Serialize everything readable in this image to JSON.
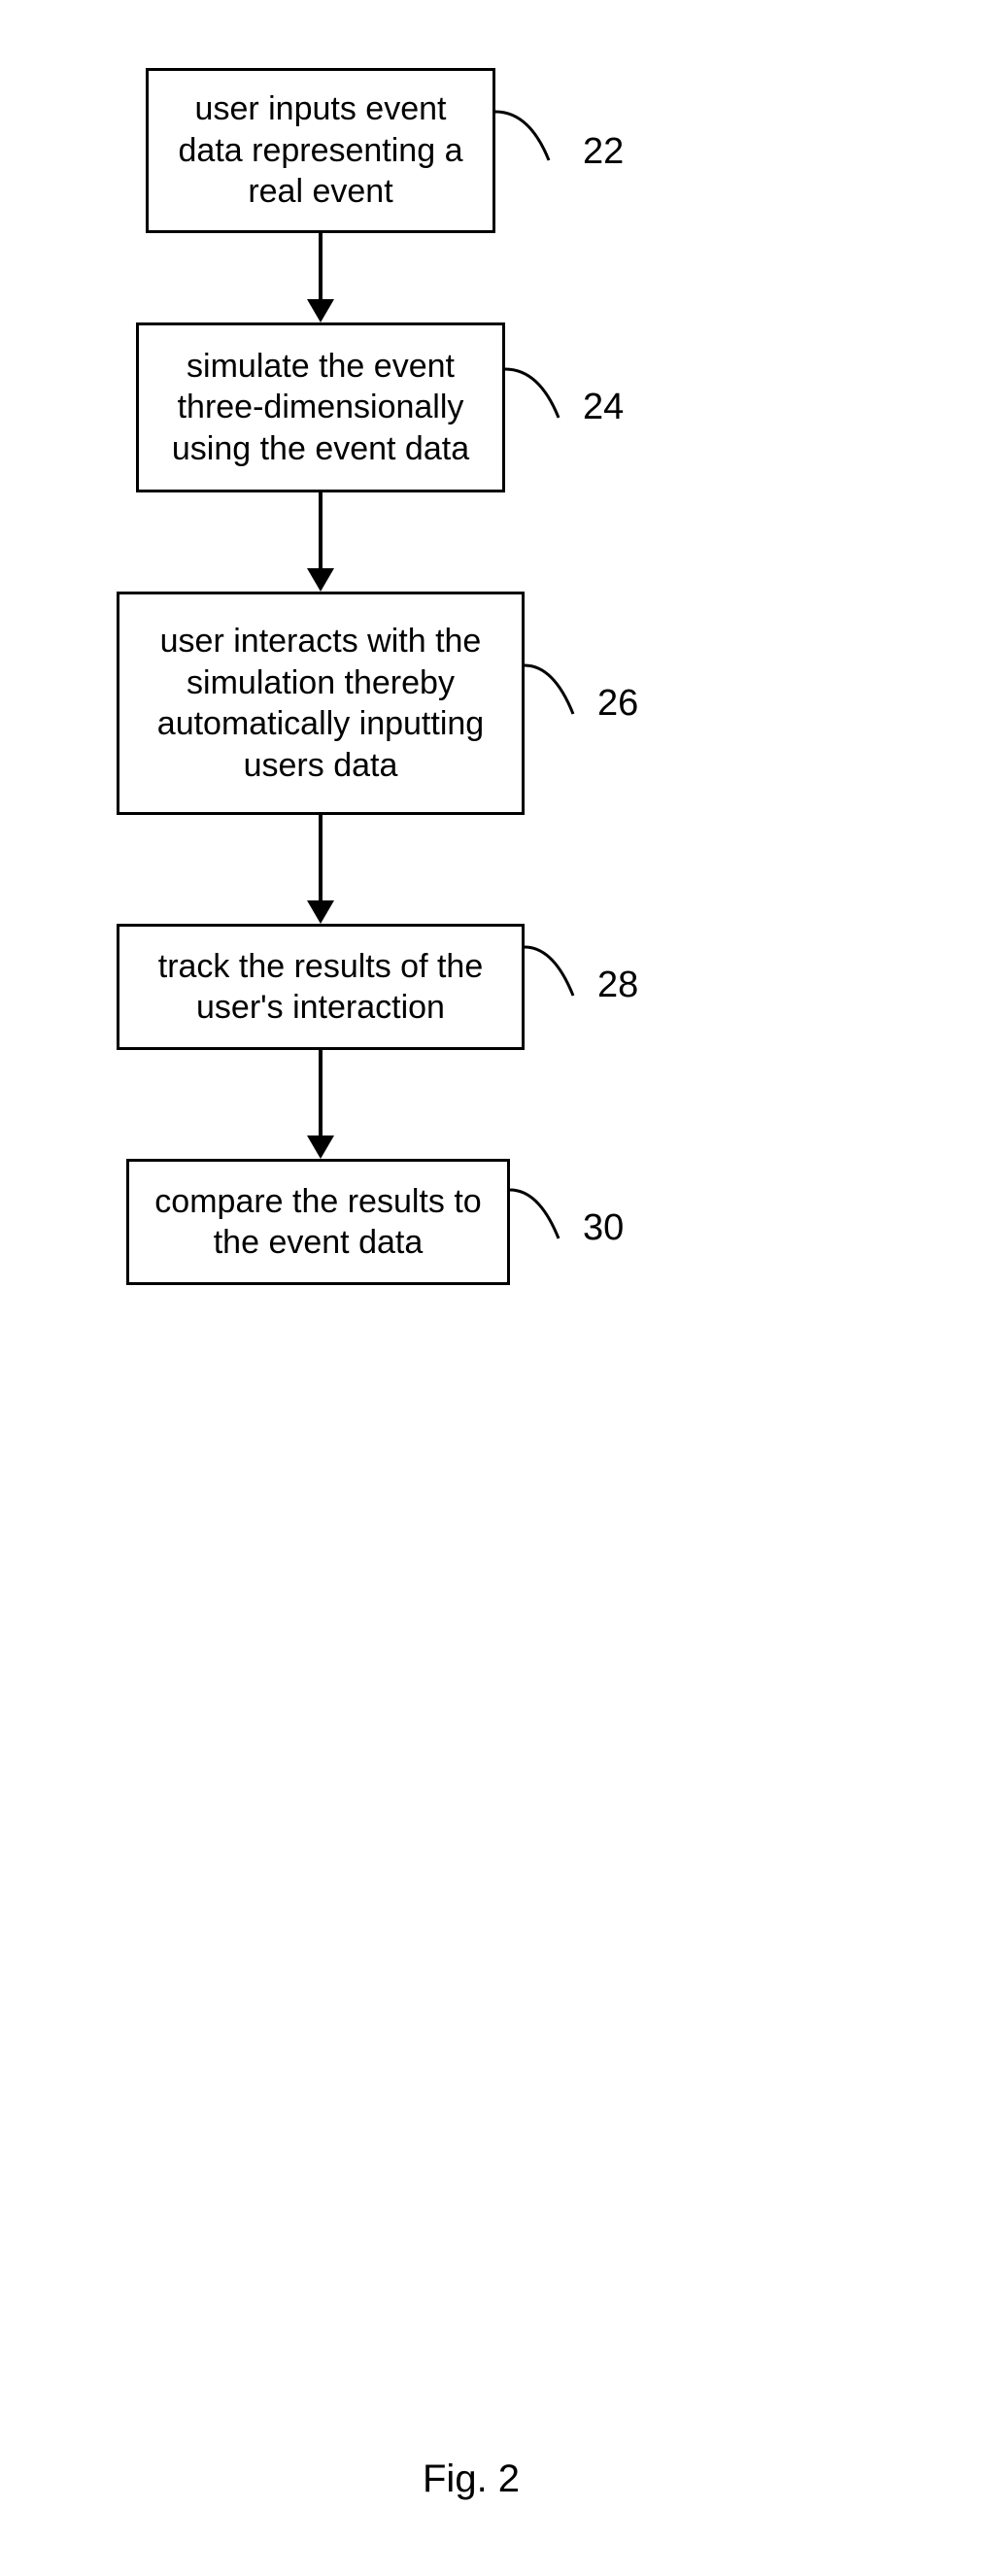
{
  "diagram": {
    "figure_caption": "Fig. 2",
    "colors": {
      "line": "#000000",
      "background": "#ffffff"
    },
    "steps": [
      {
        "id": "step-22",
        "label": "22",
        "text": "user inputs event data representing a real event"
      },
      {
        "id": "step-24",
        "label": "24",
        "text": "simulate the event three-dimensionally using the event data"
      },
      {
        "id": "step-26",
        "label": "26",
        "text": "user interacts with the simulation thereby automatically inputting users data"
      },
      {
        "id": "step-28",
        "label": "28",
        "text": "track the results of the user's interaction"
      },
      {
        "id": "step-30",
        "label": "30",
        "text": "compare the results to the event data"
      }
    ]
  }
}
